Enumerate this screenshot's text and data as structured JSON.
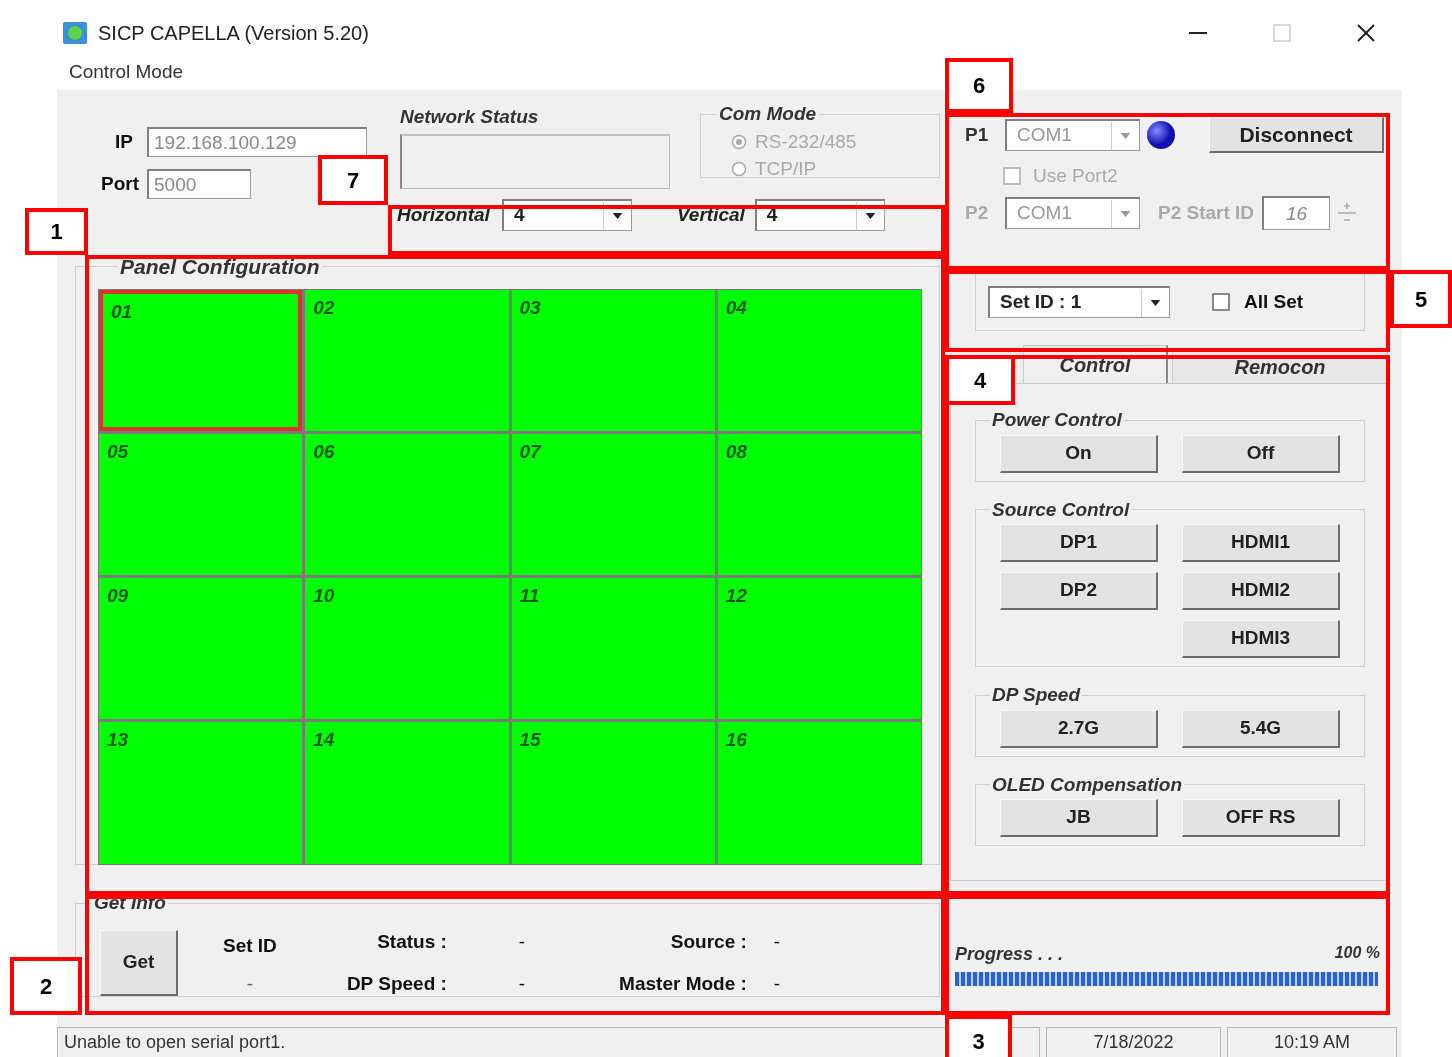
{
  "window": {
    "title": "SICP CAPELLA (Version 5.20)"
  },
  "menu": [
    "Control Mode"
  ],
  "network": {
    "ip_label": "IP",
    "ip": "192.168.100.129",
    "port_label": "Port",
    "port": "5000",
    "status_title": "Network Status"
  },
  "com_mode": {
    "title": "Com Mode",
    "disabled": true,
    "options": [
      {
        "label": "RS-232/485",
        "selected": true
      },
      {
        "label": "TCP/IP",
        "selected": false
      }
    ]
  },
  "layout": {
    "horizontal_label": "Horizontal",
    "horizontal": "4",
    "vertical_label": "Vertical",
    "vertical": "4"
  },
  "panel_configuration": {
    "title": "Panel Configuration",
    "panels": [
      {
        "label": "01",
        "selected": true
      },
      {
        "label": "02",
        "selected": false
      },
      {
        "label": "03",
        "selected": false
      },
      {
        "label": "04",
        "selected": false
      },
      {
        "label": "05",
        "selected": false
      },
      {
        "label": "06",
        "selected": false
      },
      {
        "label": "07",
        "selected": false
      },
      {
        "label": "08",
        "selected": false
      },
      {
        "label": "09",
        "selected": false
      },
      {
        "label": "10",
        "selected": false
      },
      {
        "label": "11",
        "selected": false
      },
      {
        "label": "12",
        "selected": false
      },
      {
        "label": "13",
        "selected": false
      },
      {
        "label": "14",
        "selected": false
      },
      {
        "label": "15",
        "selected": false
      },
      {
        "label": "16",
        "selected": false
      }
    ]
  },
  "get_info": {
    "title": "Get Info",
    "button": "Get",
    "set_id_label": "Set ID",
    "set_id_value": "-",
    "fields": [
      {
        "label": "Status :",
        "value": "-"
      },
      {
        "label": "Source :",
        "value": "-"
      },
      {
        "label": "DP Speed :",
        "value": "-"
      },
      {
        "label": "Master Mode :",
        "value": "-"
      }
    ]
  },
  "connection": {
    "p1_label": "P1",
    "p1": "COM1",
    "button": "Disconnect",
    "use_port2": {
      "label": "Use Port2",
      "checked": false,
      "disabled": true
    },
    "p2_disabled": true,
    "p2_label": "P2",
    "p2": "COM1",
    "p2_start_id_label": "P2 Start ID",
    "p2_start_id": "16"
  },
  "target": {
    "set_id": "Set ID : 1",
    "all_set": {
      "label": "All Set",
      "checked": false
    }
  },
  "tabs": [
    {
      "label": "Control",
      "selected": true
    },
    {
      "label": "Remocon",
      "selected": false
    }
  ],
  "groups": [
    {
      "title": "Power Control",
      "columns": [
        [
          "On"
        ],
        [
          "Off"
        ]
      ]
    },
    {
      "title": "Source Control",
      "columns": [
        [
          "DP1",
          "DP2"
        ],
        [
          "HDMI1",
          "HDMI2",
          "HDMI3"
        ]
      ]
    },
    {
      "title": "DP Speed",
      "columns": [
        [
          "2.7G"
        ],
        [
          "5.4G"
        ]
      ]
    },
    {
      "title": "OLED Compensation",
      "columns": [
        [
          "JB"
        ],
        [
          "OFF RS"
        ]
      ]
    }
  ],
  "progress": {
    "label": "Progress . . .",
    "percent": "100 %",
    "level": 1
  },
  "status_bar": [
    "Unable to open serial port1.",
    "7/18/2022",
    "10:19 AM"
  ],
  "annotations": [
    {
      "label": "6"
    },
    {
      "label": "7"
    },
    {
      "label": "1"
    },
    {
      "label": "5"
    },
    {
      "label": "4"
    },
    {
      "label": "2"
    },
    {
      "label": "3"
    }
  ]
}
